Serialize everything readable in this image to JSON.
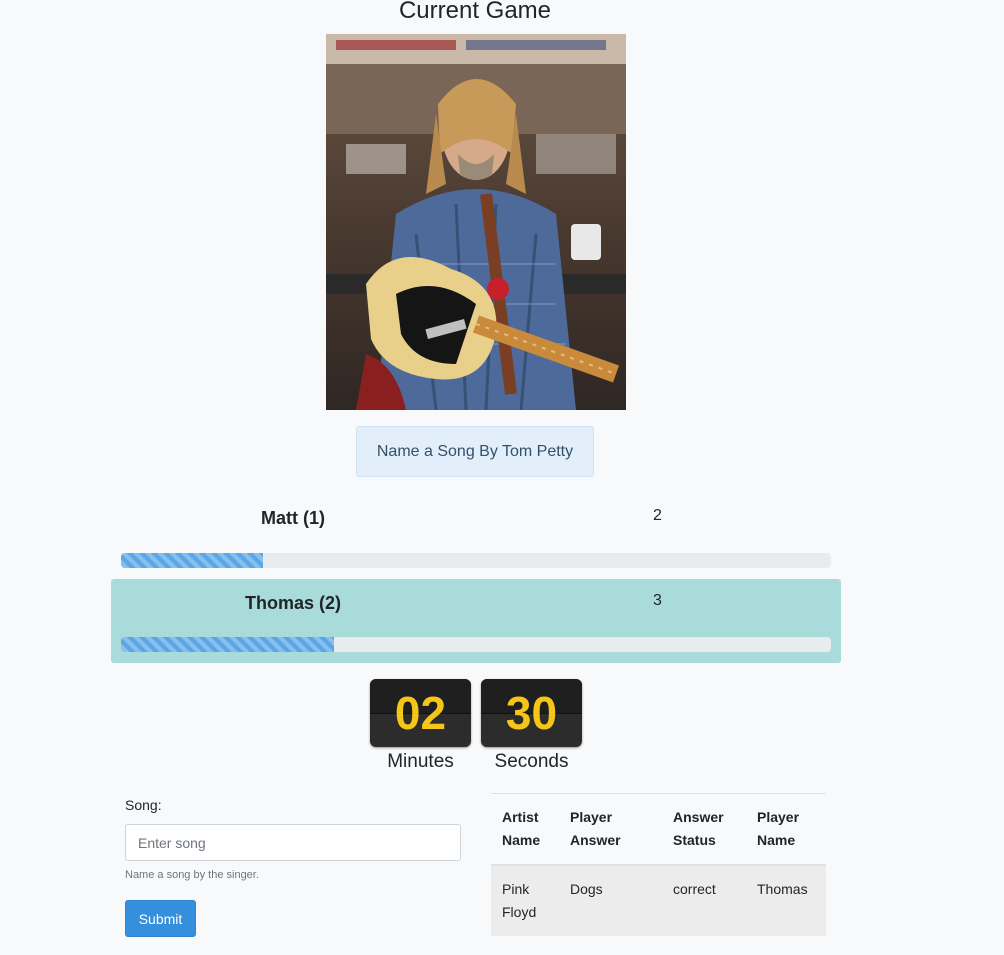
{
  "page": {
    "title": "Current Game"
  },
  "prompt": {
    "text": "Name a Song By Tom Petty"
  },
  "players": [
    {
      "name": "Matt (1)",
      "score": "2",
      "progress": 0.2,
      "active": false
    },
    {
      "name": "Thomas (2)",
      "score": "3",
      "progress": 0.3,
      "active": true
    }
  ],
  "timer": {
    "minutes": "02",
    "seconds": "30",
    "minutes_label": "Minutes",
    "seconds_label": "Seconds"
  },
  "form": {
    "label": "Song:",
    "placeholder": "Enter song",
    "value": "",
    "help": "Name a song by the singer.",
    "submit": "Submit"
  },
  "answers_table": {
    "headers": [
      "Artist Name",
      "Player Answer",
      "Answer Status",
      "Player Name"
    ],
    "rows": [
      [
        "Pink Floyd",
        "Dogs",
        "correct",
        "Thomas"
      ]
    ]
  },
  "colors": {
    "accent": "#3490dc",
    "active_row": "#a9dbdb",
    "timer_digits": "#f5c518",
    "progress": "#5aa6e6"
  }
}
